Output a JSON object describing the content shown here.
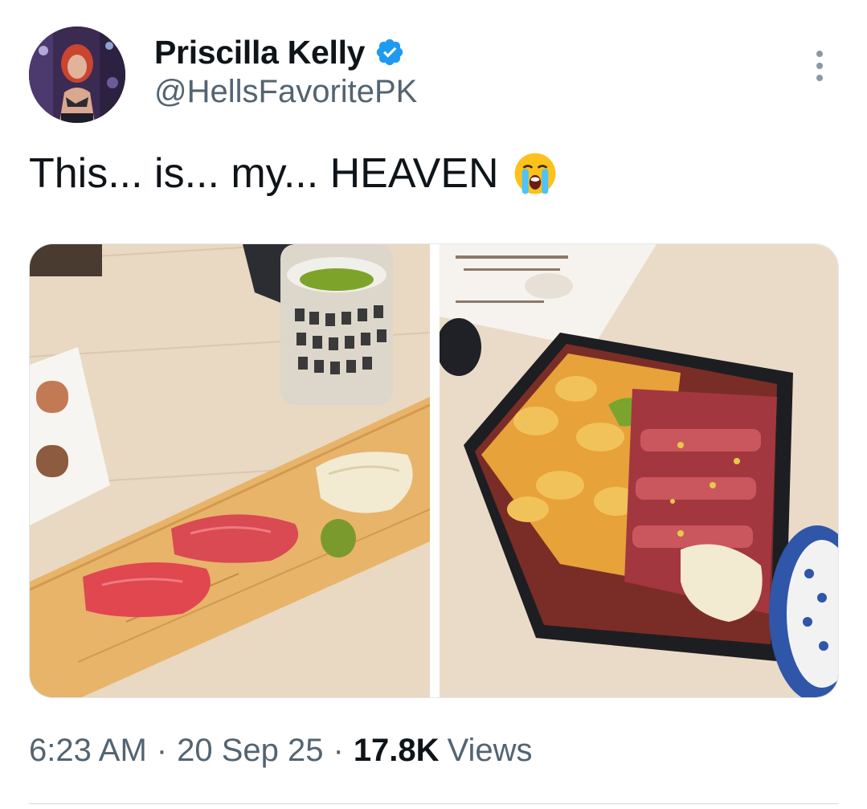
{
  "author": {
    "name": "Priscilla Kelly",
    "handle": "@HellsFavoritePK",
    "verified": true,
    "avatar": "profile-photo"
  },
  "tweet": {
    "text": "This... is... my... HEAVEN",
    "emoji": "loudly-crying-face-emoji"
  },
  "media": [
    {
      "name": "nigiri-sushi-photo"
    },
    {
      "name": "uni-wagyu-rice-bowl-photo"
    }
  ],
  "meta": {
    "time": "6:23 AM",
    "separator": "·",
    "date": "20 Sep 25",
    "views_count": "17.8K",
    "views_label": "Views"
  },
  "colors": {
    "verified": "#1d9bf0",
    "secondary_text": "#536471",
    "primary_text": "#0f1419"
  }
}
